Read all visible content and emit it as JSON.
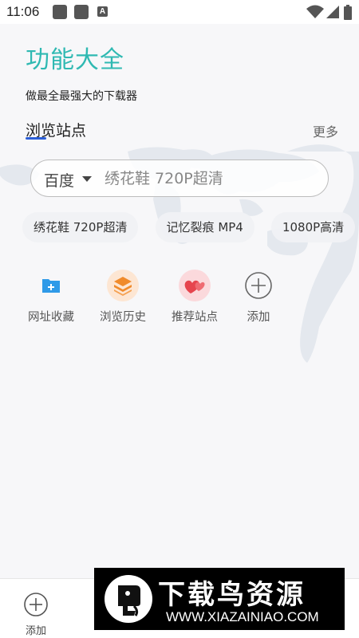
{
  "status_bar": {
    "time": "11:06",
    "notification_letter": "A",
    "icons": [
      "notification-square-icon",
      "notification-square-icon",
      "text-a-icon",
      "wifi-icon",
      "signal-icon",
      "battery-icon"
    ]
  },
  "header": {
    "title": "功能大全",
    "subtitle": "做最全最强大的下载器"
  },
  "browse_section": {
    "title": "浏览站点",
    "more_label": "更多"
  },
  "search": {
    "engine": "百度",
    "placeholder": "绣花鞋 720P超清"
  },
  "suggestions": [
    "绣花鞋 720P超清",
    "记忆裂痕 MP4",
    "1080P高清"
  ],
  "functions": [
    {
      "label": "网址收藏",
      "icon": "bookmark-folder-icon"
    },
    {
      "label": "浏览历史",
      "icon": "history-layers-icon"
    },
    {
      "label": "推荐站点",
      "icon": "recommend-hearts-icon"
    },
    {
      "label": "添加",
      "icon": "add-circle-icon"
    }
  ],
  "bottom_nav": [
    {
      "label": "添加",
      "icon": "add-circle-icon"
    }
  ],
  "watermark": {
    "text": "下载鸟资源",
    "url": "WWW.XIAZAINIAO.COM"
  },
  "colors": {
    "accent": "#2fb9b2",
    "underline": "#2c5fd8",
    "bookmark_icon": "#2f9ae8",
    "history_icon": "#f08b2c",
    "recommend_icon": "#e6454e"
  }
}
